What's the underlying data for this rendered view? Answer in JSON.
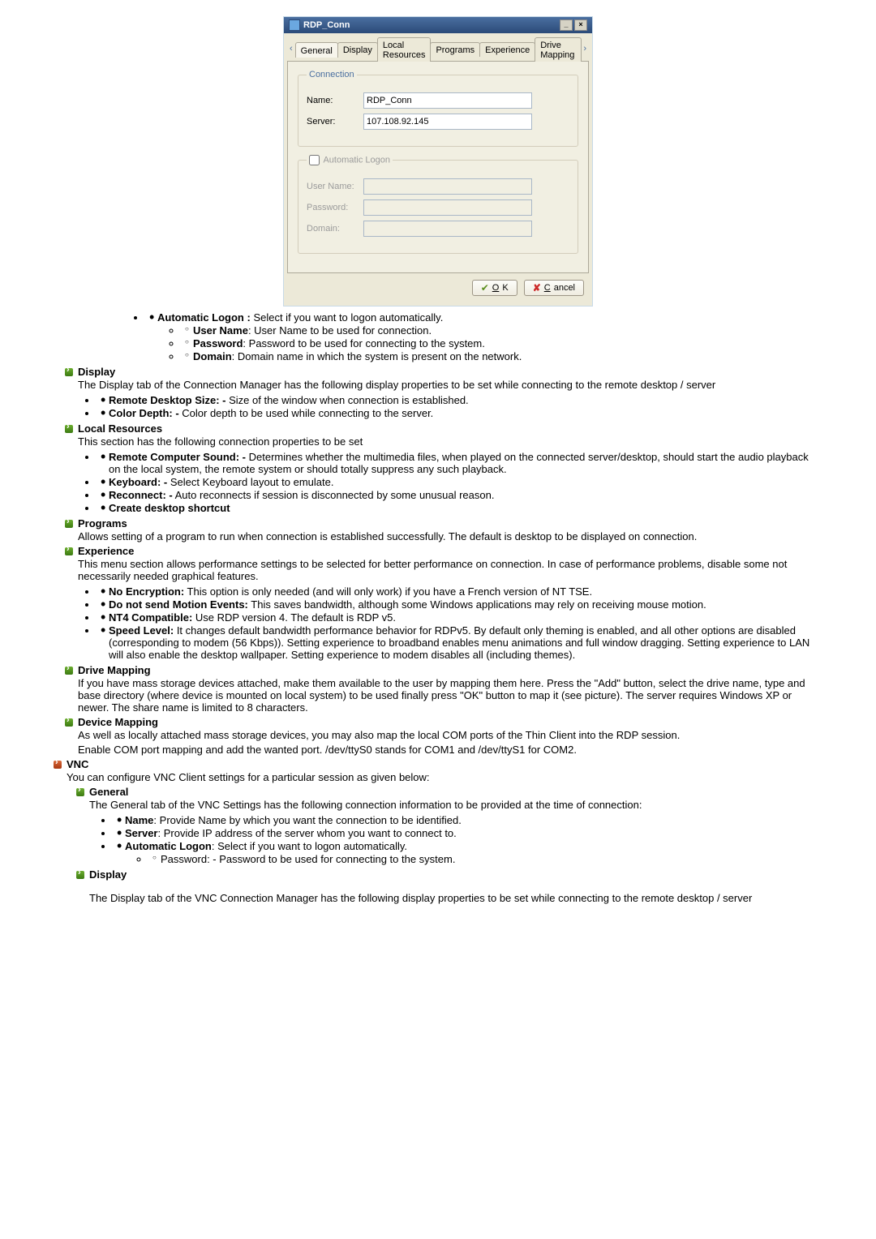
{
  "dialog": {
    "title": "RDP_Conn",
    "tabs": [
      "General",
      "Display",
      "Local Resources",
      "Programs",
      "Experience",
      "Drive Mapping"
    ],
    "group1_title": "Connection",
    "name_label": "Name:",
    "name_value": "RDP_Conn",
    "server_label": "Server:",
    "server_value": "107.108.92.145",
    "group2_title": "Automatic Logon",
    "user_label": "User Name:",
    "pwd_label": "Password:",
    "domain_label": "Domain:",
    "ok_label": "OK",
    "cancel_label": "Cancel"
  },
  "doc": {
    "auto_logon_head": "Automatic Logon :",
    "auto_logon_desc": " Select if you want to logon automatically.",
    "user_name_b": "User Name",
    "user_name_t": ": User Name to be used for connection.",
    "password_b": "Password",
    "password_t": ": Password to be used for connecting to the system.",
    "domain_b": "Domain",
    "domain_t": ": Domain name in which the system is present on the network.",
    "display_head": "Display",
    "display_p": "The Display tab of the Connection Manager has the following display properties to be set while connecting to the remote desktop / server",
    "rds_b": "Remote Desktop Size: -",
    "rds_t": " Size of the window when connection is established.",
    "cd_b": "Color Depth: -",
    "cd_t": " Color depth to be used while connecting to the server.",
    "lr_head": "Local Resources",
    "lr_p": "This section has the following connection properties to be set",
    "rcs_b": "Remote Computer Sound: -",
    "rcs_t": " Determines whether the multimedia files, when played on the connected server/desktop, should start the audio playback on the local system, the remote system or should totally suppress any such playback.",
    "kb_b": "Keyboard: -",
    "kb_t": " Select Keyboard layout to emulate.",
    "rc_b": "Reconnect: -",
    "rc_t": " Auto reconnects if session is disconnected by some unusual reason.",
    "cds_b": "Create desktop shortcut",
    "prog_head": "Programs",
    "prog_p": "Allows setting of a program to run when connection is established successfully. The default is desktop to be displayed on connection.",
    "exp_head": "Experience",
    "exp_p": "This menu section allows performance settings to be selected for better performance on connection. In case of performance problems, disable some not necessarily needed graphical features.",
    "ne_b": "No Encryption:",
    "ne_t": " This option is only needed (and will only work) if you have a French version of NT TSE.",
    "dme_b": "Do not send Motion Events:",
    "dme_t": " This saves bandwidth, although some Windows applications may rely on receiving mouse motion.",
    "nt4_b": "NT4 Compatible:",
    "nt4_t": " Use RDP version 4. The default is RDP v5.",
    "sl_b": "Speed Level:",
    "sl_t": "  It changes default bandwidth performance behavior for RDPv5. By default only theming is enabled, and all other options are disabled (corresponding to modem (56 Kbps)). Setting experience to broadband enables menu animations and full window dragging.  Setting experience to LAN will also enable the desktop wallpaper. Setting experience to modem disables all (including themes).",
    "dm_head": "Drive Mapping",
    "dm_p": "If you have mass storage devices attached, make them available to the user by mapping them here. Press the \"Add\" button, select the drive name, type and base directory (where device is mounted on local system) to be used finally press \"OK\" button to map it (see picture). The server requires Windows XP or newer. The share name is limited to 8 characters.",
    "devm_head": "Device Mapping",
    "devm_p1": "As well as locally attached mass storage devices, you may also map the local COM ports of the Thin Client into the RDP session.",
    "devm_p2": "Enable COM port mapping and add the wanted port. /dev/ttyS0 stands for COM1 and /dev/ttyS1 for COM2.",
    "vnc_head": "VNC",
    "vnc_p": "You can configure VNC Client settings for a particular session as given below:",
    "vgen_head": "General",
    "vgen_p": "The General tab of the VNC Settings has the following connection information to be provided at the time of connection:",
    "vname_b": "Name",
    "vname_t": ": Provide Name by which you want the connection to be identified.",
    "vserver_b": "Server",
    "vserver_t": ": Provide IP address of the server whom you want to connect to.",
    "vauto_b": "Automatic Logon",
    "vauto_t": ": Select if you want to logon automatically.",
    "vpwd_t": "Password: - Password to be used for connecting to the system.",
    "vdisp_head": "Display",
    "vdisp_p": "The Display tab of the VNC Connection Manager has the following display properties to be set while connecting to the remote desktop / server"
  }
}
